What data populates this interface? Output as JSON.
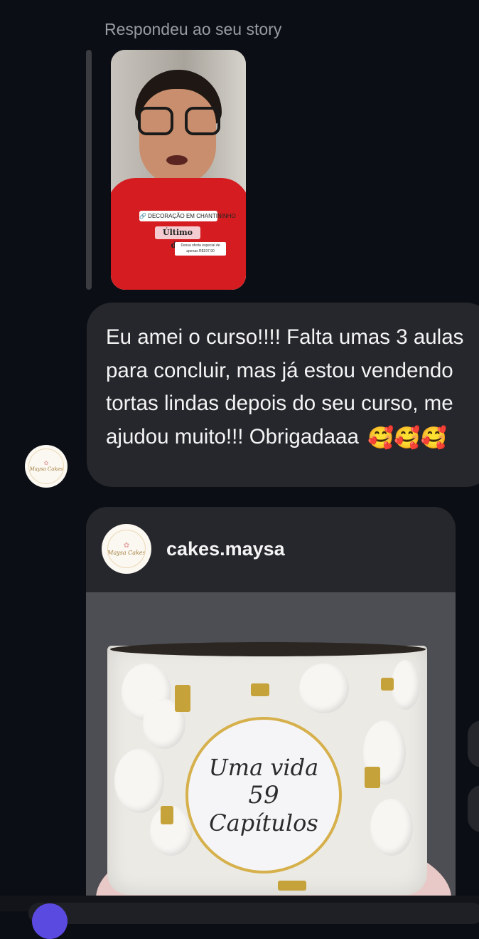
{
  "reply": {
    "label": "Respondeu ao seu story"
  },
  "story": {
    "sticker_link": "🔗 DECORAÇÃO EM CHANTININHO",
    "sticker_title": "Último dia",
    "sticker_offer": "Dessa oferta especial de apenas R$197,90"
  },
  "message": {
    "text": "Eu amei o curso!!!! Falta umas 3 aulas para concluir, mas já estou vendendo tortas lindas depois do seu curso, me ajudou muito!!! Obrigadaaa",
    "emojis": "🥰🥰🥰"
  },
  "sender_avatar": {
    "logo_text": "Maysa Cakes",
    "icon": "cake-logo-avatar"
  },
  "shared_post": {
    "username": "cakes.maysa",
    "avatar_logo_text": "Maysa Cakes",
    "topper_line1": "Uma vida",
    "topper_line2": "59",
    "topper_line3": "Capítulos"
  },
  "colors": {
    "background": "#0b0e14",
    "bubble": "#25272c",
    "secondary_text": "#9a9ca3",
    "accent": "#5b4ae0"
  }
}
